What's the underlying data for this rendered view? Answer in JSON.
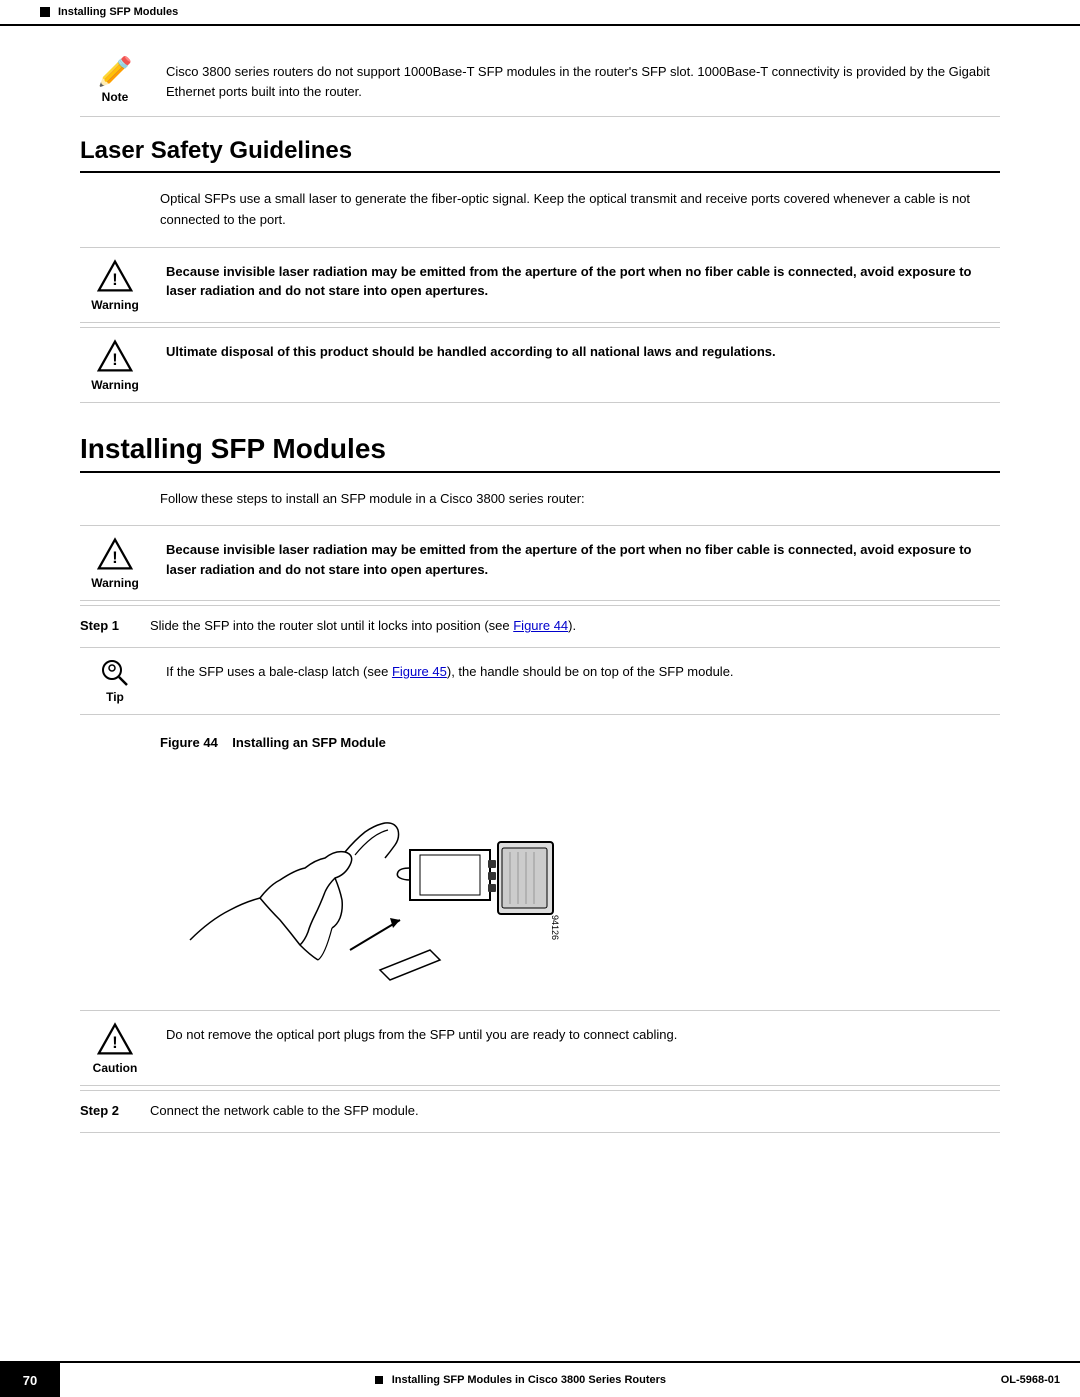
{
  "topbar": {
    "label": "Installing SFP Modules"
  },
  "note": {
    "label": "Note",
    "text": "Cisco 3800 series routers do not support 1000Base-T SFP modules in the router's SFP slot. 1000Base-T connectivity is provided by the Gigabit Ethernet ports built into the router."
  },
  "laser_safety": {
    "heading": "Laser Safety Guidelines",
    "body": "Optical SFPs use a small laser to generate the fiber-optic signal. Keep the optical transmit and receive ports covered whenever a cable is not connected to the port."
  },
  "warning1": {
    "label": "Warning",
    "text": "Because invisible laser radiation may be emitted from the aperture of the port when no fiber cable is connected, avoid exposure to laser radiation and do not stare into open apertures."
  },
  "warning2": {
    "label": "Warning",
    "text": "Ultimate disposal of this product should be handled according to all national laws and regulations."
  },
  "installing_sfp": {
    "heading": "Installing SFP Modules",
    "body": "Follow these steps to install an SFP module in a Cisco 3800 series router:"
  },
  "warning3": {
    "label": "Warning",
    "text": "Because invisible laser radiation may be emitted from the aperture of the port when no fiber cable is connected, avoid exposure to laser radiation and do not stare into open apertures."
  },
  "step1": {
    "label": "Step 1",
    "text_before": "Slide the SFP into the router slot until it locks into position (see ",
    "link": "Figure 44",
    "text_after": ")."
  },
  "tip": {
    "label": "Tip",
    "text_before": "If the SFP uses a bale-clasp latch (see ",
    "link": "Figure 45",
    "text_after": "), the handle should be on top of the SFP module."
  },
  "figure": {
    "number": "Figure 44",
    "caption": "Installing an SFP Module",
    "id_label": "94126"
  },
  "caution": {
    "label": "Caution",
    "text": "Do not remove the optical port plugs from the SFP until you are ready to connect cabling."
  },
  "step2": {
    "label": "Step 2",
    "text": "Connect the network cable to the SFP module."
  },
  "footer": {
    "page_number": "70",
    "center_text": "Installing SFP Modules in Cisco 3800 Series Routers",
    "right_text": "OL-5968-01"
  }
}
